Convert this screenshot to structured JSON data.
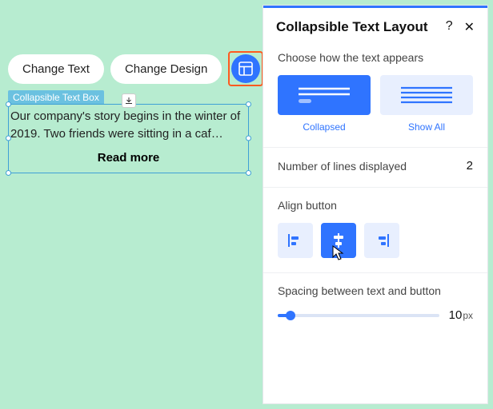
{
  "toolbar": {
    "change_text": "Change Text",
    "change_design": "Change Design"
  },
  "widget": {
    "tag": "Collapsible Text Box",
    "body": "Our company's story begins in the winter of 2019. Two friends were sitting in a caf…",
    "read_more": "Read more"
  },
  "panel": {
    "title": "Collapsible Text Layout",
    "help": "?",
    "close": "✕",
    "appearance": {
      "label": "Choose how the text appears",
      "collapsed": "Collapsed",
      "show_all": "Show All"
    },
    "lines": {
      "label": "Number of lines displayed",
      "value": "2"
    },
    "align": {
      "label": "Align button"
    },
    "spacing": {
      "label": "Spacing between text and button",
      "value": "10",
      "unit": "px"
    }
  }
}
